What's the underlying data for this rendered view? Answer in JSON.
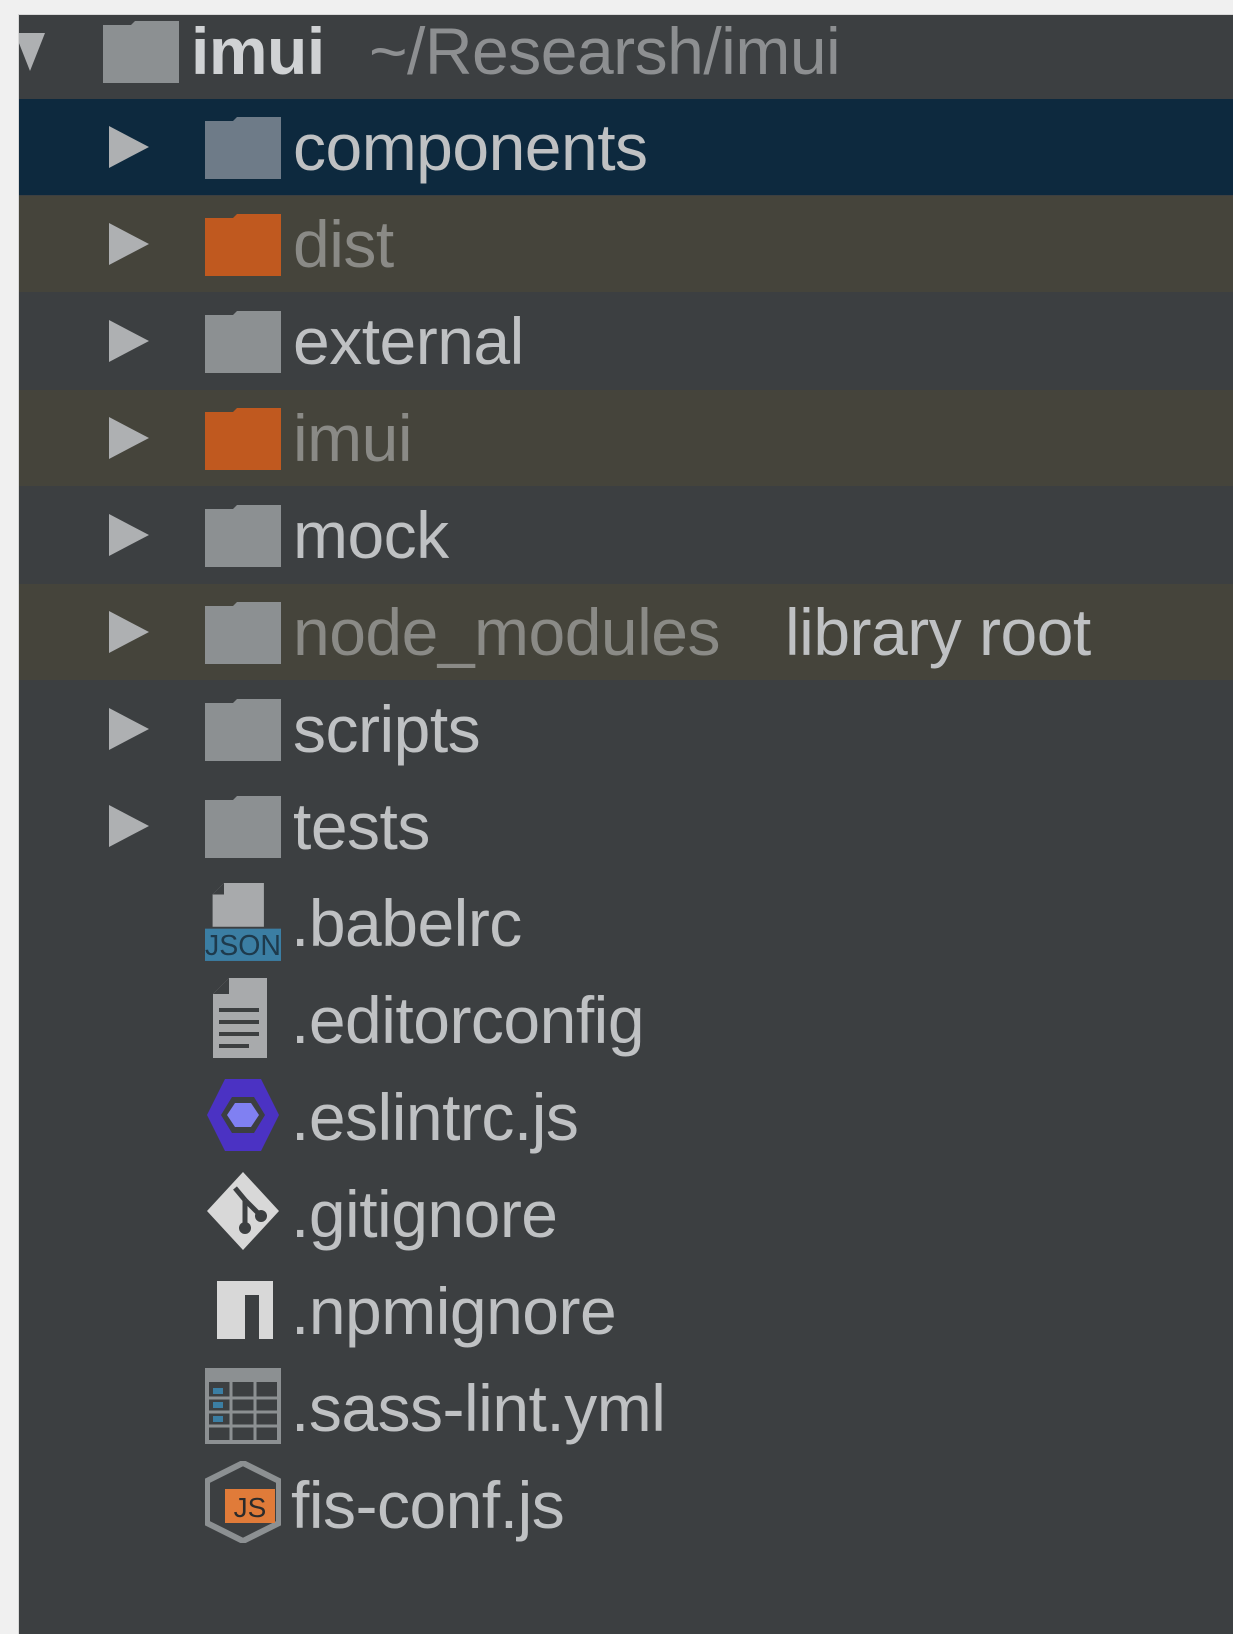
{
  "root": {
    "name": "imui",
    "path": "~/Researsh/imui"
  },
  "folders": [
    {
      "label": "components",
      "state": "selected",
      "color": "#6e7b88"
    },
    {
      "label": "dist",
      "state": "excluded",
      "color": "#c0591f"
    },
    {
      "label": "external",
      "state": "normal",
      "color": "#8c9092"
    },
    {
      "label": "imui",
      "state": "excluded",
      "color": "#c0591f"
    },
    {
      "label": "mock",
      "state": "normal",
      "color": "#8c9092"
    },
    {
      "label": "node_modules",
      "note": "library root",
      "state": "excluded",
      "color": "#8c9092"
    },
    {
      "label": "scripts",
      "state": "normal",
      "color": "#8c9092"
    },
    {
      "label": "tests",
      "state": "normal",
      "color": "#8c9092"
    }
  ],
  "files": [
    {
      "label": ".babelrc",
      "icon": "json-file-icon",
      "icon_text": "JSON"
    },
    {
      "label": ".editorconfig",
      "icon": "text-file-icon"
    },
    {
      "label": ".eslintrc.js",
      "icon": "eslint-icon"
    },
    {
      "label": ".gitignore",
      "icon": "git-icon"
    },
    {
      "label": ".npmignore",
      "icon": "npm-icon"
    },
    {
      "label": ".sass-lint.yml",
      "icon": "yaml-file-icon"
    },
    {
      "label": "fis-conf.js",
      "icon": "fis-js-icon",
      "icon_text": "JS"
    }
  ],
  "colors": {
    "background": "#3c3f41",
    "selected": "#0d293e",
    "excluded": "#45443b",
    "text": "#bfc1c3",
    "dim_text": "#8a8a86"
  }
}
